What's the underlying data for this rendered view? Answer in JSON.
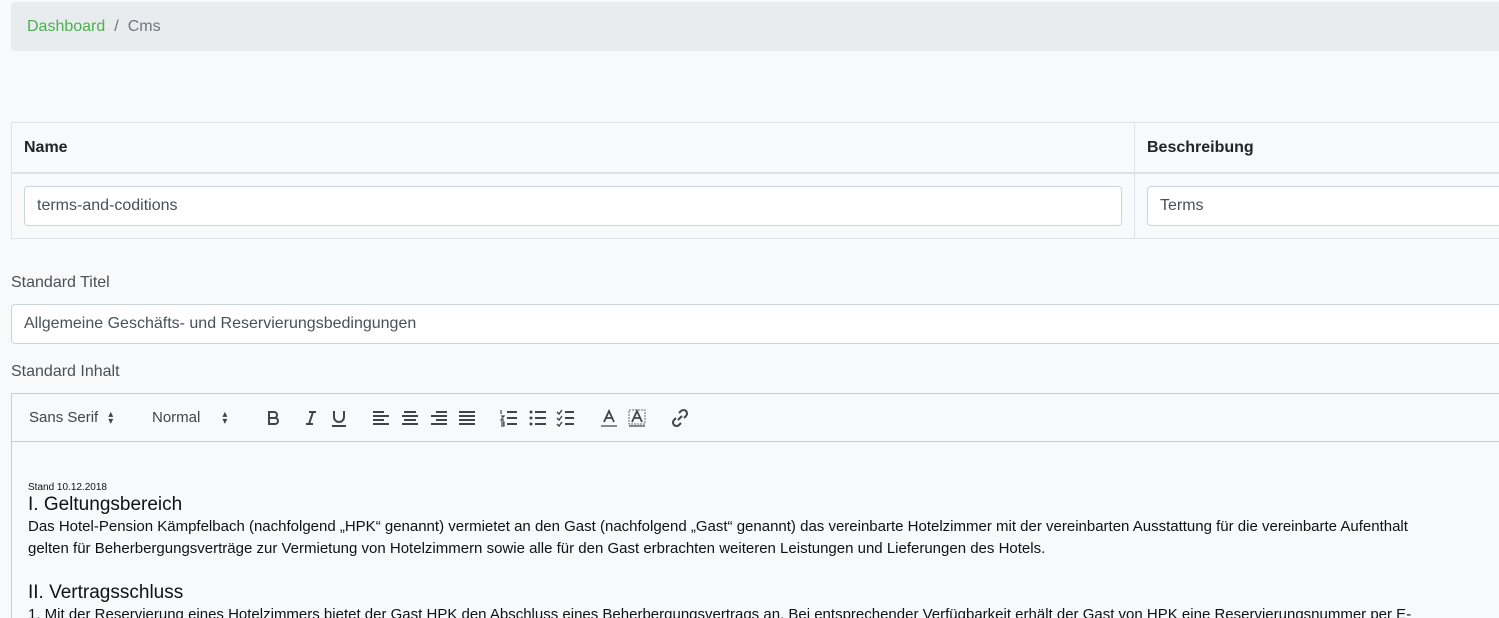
{
  "breadcrumb": {
    "home": "Dashboard",
    "separator": "/",
    "current": "Cms"
  },
  "table": {
    "headers": [
      "Name",
      "Beschreibung"
    ],
    "values": [
      "terms-and-coditions",
      "Terms"
    ]
  },
  "standard_titel": {
    "label": "Standard Titel",
    "value": "Allgemeine Geschäfts- und Reservierungsbedingungen"
  },
  "standard_inhalt": {
    "label": "Standard Inhalt"
  },
  "toolbar": {
    "font": "Sans Serif",
    "size": "Normal",
    "icons": [
      "bold-icon",
      "italic-icon",
      "underline-icon",
      "align-left-icon",
      "align-center-icon",
      "align-right-icon",
      "align-justify-icon",
      "ordered-list-icon",
      "bullet-list-icon",
      "check-list-icon",
      "text-color-icon",
      "background-color-icon",
      "link-icon"
    ]
  },
  "content": {
    "stand": "Stand 10.12.2018",
    "section1_title": "I. Geltungsbereich",
    "section1_line1": "Das Hotel-Pension Kämpfelbach (nachfolgend „HPK“ genannt) vermietet an den Gast (nachfolgend „Gast“ genannt) das vereinbarte Hotelzimmer mit der vereinbarten Ausstattung für die vereinbarte Aufenthalt",
    "section1_line2": "gelten für Beherbergungsverträge zur Vermietung von Hotelzimmern sowie alle für den Gast erbrachten weiteren Leistungen und Lieferungen des Hotels.",
    "section2_title": "II. Vertragsschluss",
    "section2_line1": "1. Mit der Reservierung eines Hotelzimmers bietet der Gast HPK den Abschluss eines Beherbergungsvertrags an. Bei entsprechender Verfügbarkeit erhält der Gast von HPK eine Reservierungsnummer per E-"
  }
}
